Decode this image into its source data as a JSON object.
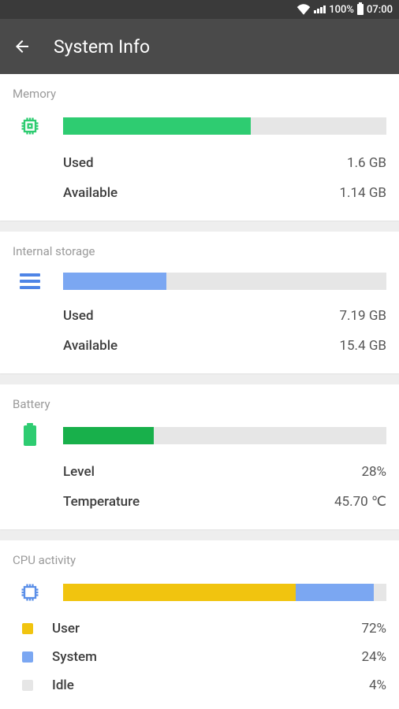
{
  "status": {
    "battery_pct": "100%",
    "time": "07:00"
  },
  "header": {
    "title": "System Info"
  },
  "memory": {
    "title": "Memory",
    "used_label": "Used",
    "used_value": "1.6 GB",
    "available_label": "Available",
    "available_value": "1.14 GB",
    "fill_pct": 58,
    "fill_color": "#2ecc71"
  },
  "storage": {
    "title": "Internal storage",
    "used_label": "Used",
    "used_value": "7.19 GB",
    "available_label": "Available",
    "available_value": "15.4 GB",
    "fill_pct": 32,
    "fill_color": "#7ba7f2"
  },
  "battery": {
    "title": "Battery",
    "level_label": "Level",
    "level_value": "28%",
    "temp_label": "Temperature",
    "temp_value": "45.70 ℃",
    "fill_pct": 28,
    "fill_color": "#18b04b"
  },
  "cpu": {
    "title": "CPU activity",
    "segments": [
      {
        "name": "User",
        "pct": 72,
        "color": "#f1c40f"
      },
      {
        "name": "System",
        "pct": 24,
        "color": "#7ba7f2"
      },
      {
        "name": "Idle",
        "pct": 4,
        "color": "#e6e6e6"
      }
    ]
  }
}
